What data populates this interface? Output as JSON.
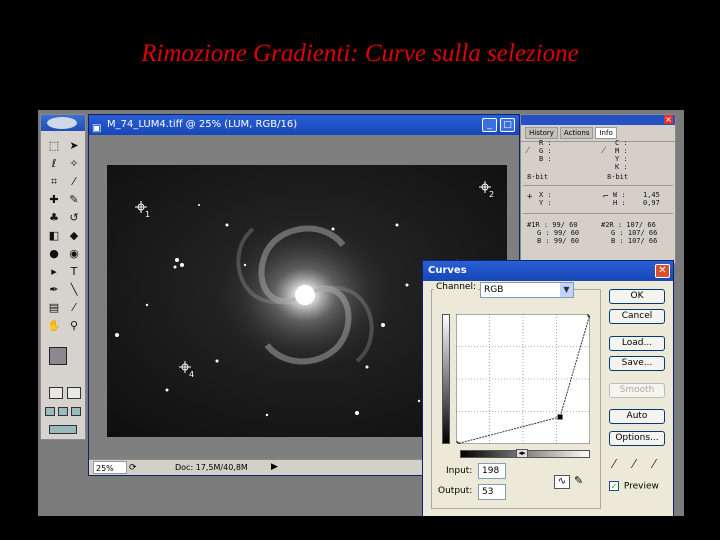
{
  "slide": {
    "title": "Rimozione Gradienti: Curve sulla selezione"
  },
  "document": {
    "title": "M_74_LUM4.tiff @ 25% (LUM, RGB/16)",
    "zoom": "25%",
    "doc_info": "Doc: 17,5M/40,8M",
    "markers": [
      "1",
      "2",
      "4"
    ]
  },
  "info_palette": {
    "tabs": [
      "History",
      "Actions",
      "Info"
    ],
    "active_tab": "Info",
    "rgb_labels": [
      "R :",
      "G :",
      "B :"
    ],
    "cmyk_labels": [
      "C :",
      "M :",
      "Y :",
      "K :"
    ],
    "bit_left": "8-bit",
    "bit_right": "8-bit",
    "xy_labels": [
      "X :",
      "Y :"
    ],
    "wh_labels": [
      "W :",
      "H :"
    ],
    "w_value": "1,45",
    "h_value": "0,97",
    "sample1": [
      "#1R :   99/  60",
      "G :   99/  60",
      "B :   99/  60"
    ],
    "sample2": [
      "#2R :   107/  66",
      "G :   107/  66",
      "B :   107/  66"
    ]
  },
  "curves": {
    "title": "Curves",
    "channel_label": "Channel:",
    "channel_value": "RGB",
    "input_label": "Input:",
    "input_value": "198",
    "output_label": "Output:",
    "output_value": "53",
    "buttons": {
      "ok": "OK",
      "cancel": "Cancel",
      "load": "Load...",
      "save": "Save...",
      "smooth": "Smooth",
      "auto": "Auto",
      "options": "Options..."
    },
    "preview_label": "Preview",
    "preview_checked": true,
    "curve_points": [
      [
        0,
        0
      ],
      [
        198,
        53
      ],
      [
        255,
        255
      ]
    ]
  }
}
